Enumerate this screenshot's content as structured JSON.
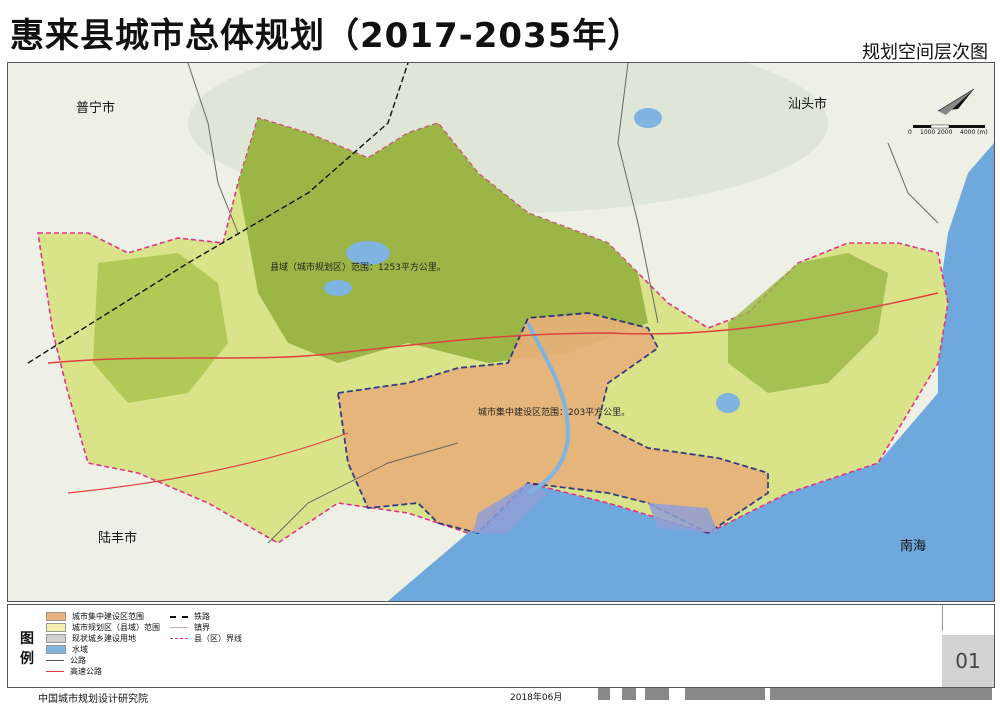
{
  "header": {
    "title": "惠来县城市总体规划（2017-2035年）",
    "subtitle": "规划空间层次图"
  },
  "map": {
    "places": {
      "puning": "普宁市",
      "shantou": "汕头市",
      "lufeng": "陆丰市",
      "nanhai": "南海"
    },
    "annotations": {
      "county_area": "县域（城市规划区）范围：1253平方公里。",
      "urban_area": "城市集中建设区范围：203平方公里。"
    },
    "scale_bar": {
      "s0": "0",
      "s1": "1000 2000",
      "s2": "4000 (m)"
    },
    "colors": {
      "sea": "#6fa8dc",
      "county_fill": "#d9e48a",
      "urban_fill": "#e8b07a",
      "boundary": "#e0338a",
      "urban_boundary": "#1c2d80",
      "highway": "#e04040"
    }
  },
  "legend": {
    "title": "图例",
    "items": [
      {
        "label": "城市集中建设区范围",
        "kind": "fill",
        "color": "#e8b07a"
      },
      {
        "label": "城市规划区（县域）范围",
        "kind": "fill",
        "color": "#f5f0b0"
      },
      {
        "label": "现状城乡建设用地",
        "kind": "fill",
        "color": "#cfcfcf"
      },
      {
        "label": "水域",
        "kind": "fill",
        "color": "#7fb3e0"
      },
      {
        "label": "公路",
        "kind": "line",
        "color": "#555555"
      },
      {
        "label": "高速公路",
        "kind": "line",
        "color": "#e04040"
      },
      {
        "label": "铁路",
        "kind": "dash",
        "color": "#111111"
      },
      {
        "label": "镇界",
        "kind": "line",
        "color": "#c8a8d8"
      },
      {
        "label": "县（区）界线",
        "kind": "dash",
        "color": "#e0338a"
      }
    ]
  },
  "page_number": "01",
  "footer": {
    "institute": "中国城市规划设计研究院",
    "date": "2018年06月"
  }
}
